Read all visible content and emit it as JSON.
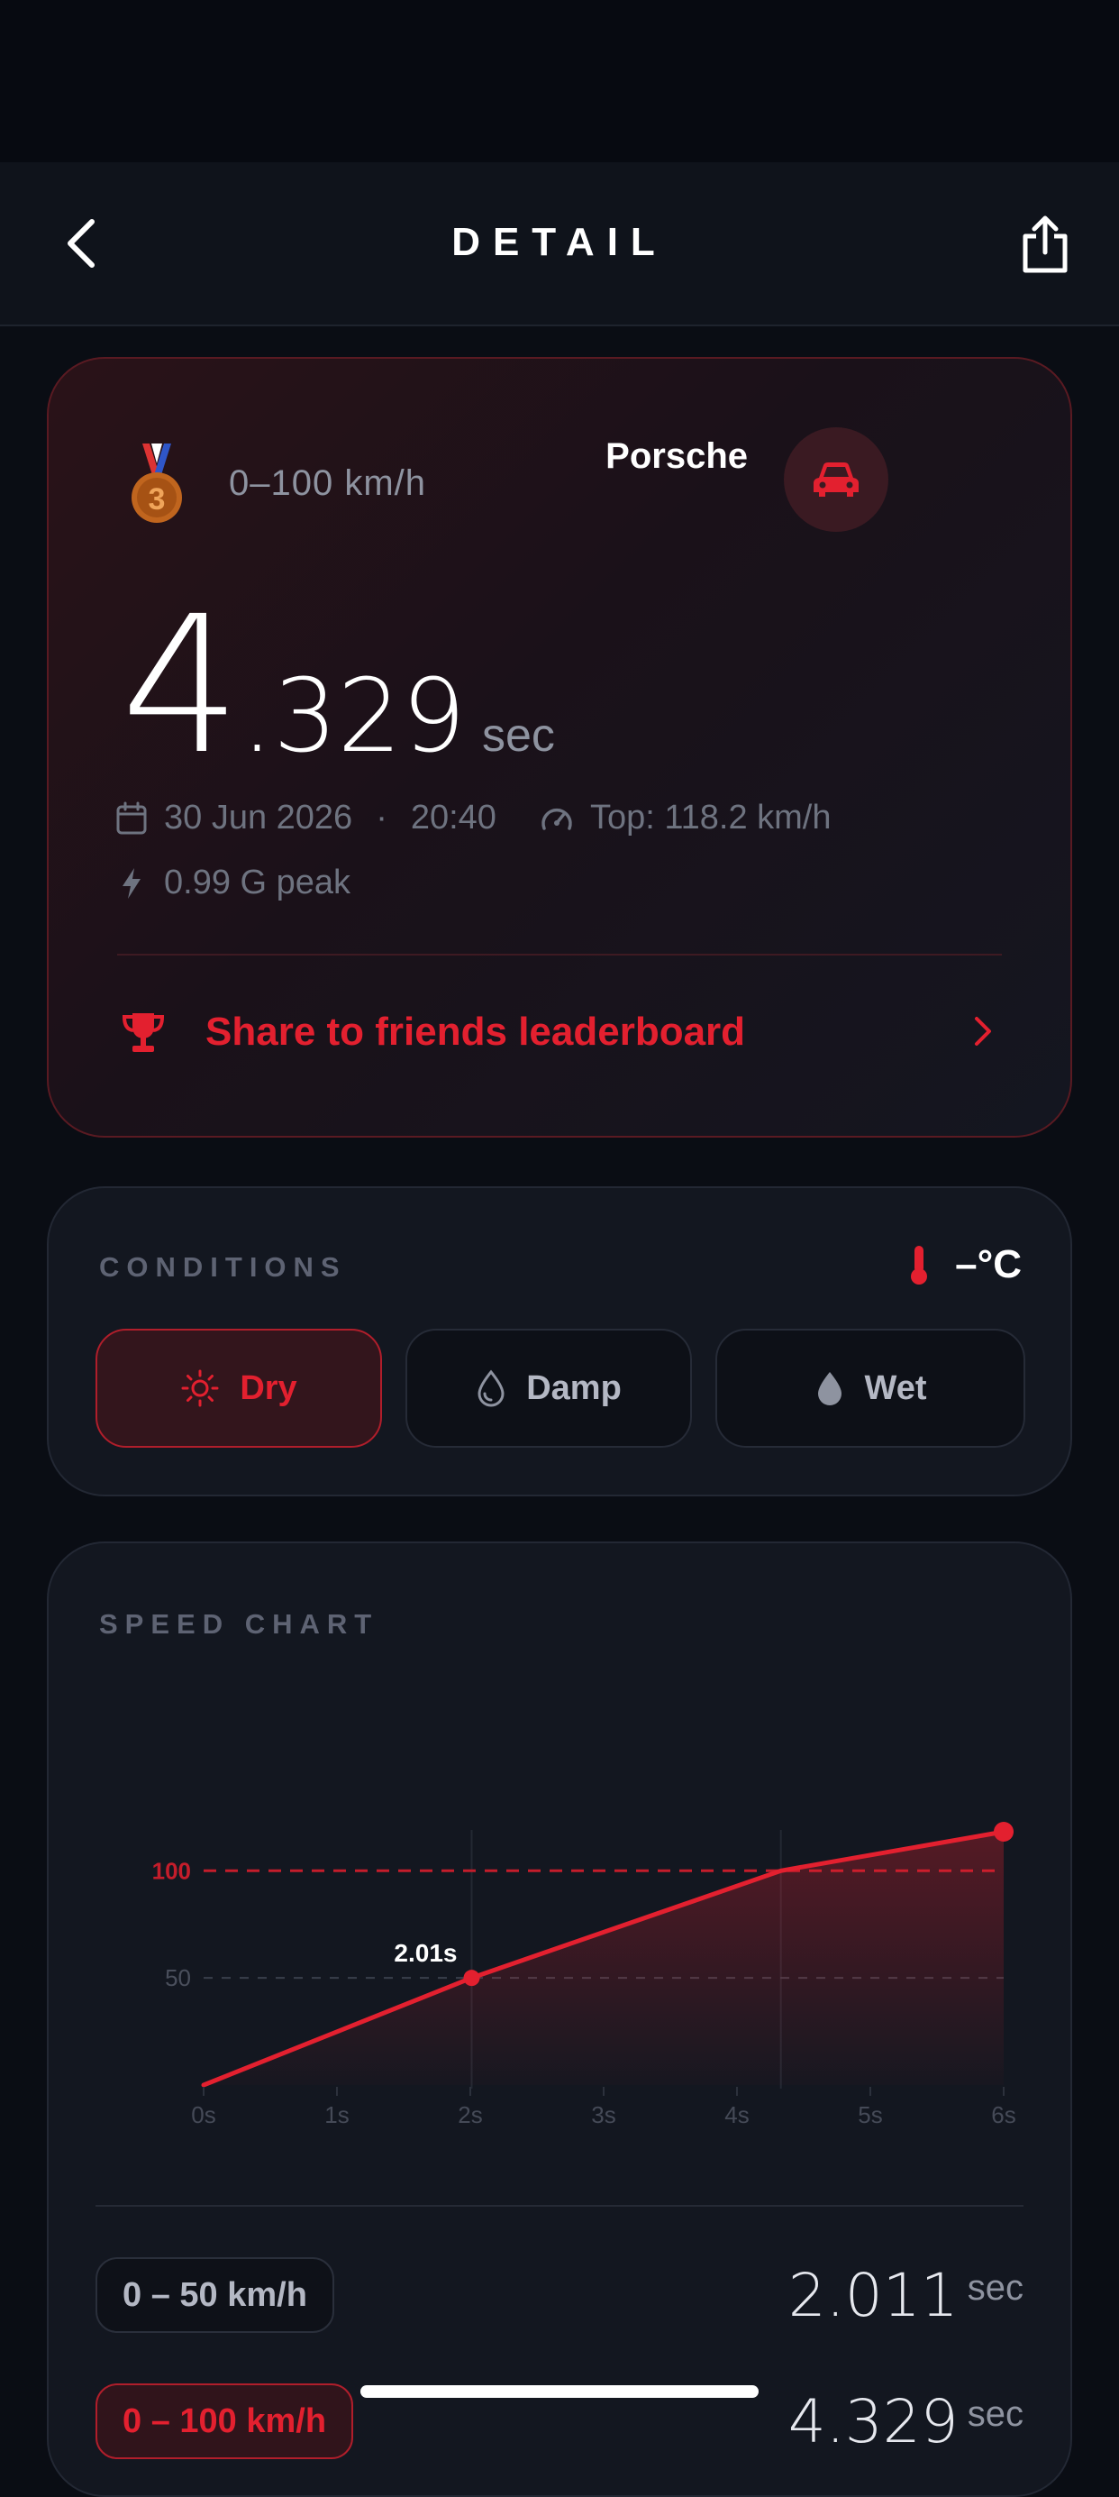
{
  "nav": {
    "title": "DETAIL"
  },
  "hero": {
    "metric_label": "0–100 km/h",
    "car_name": "Porsche",
    "time_integer": "4",
    "time_decimal": ".329",
    "time_unit": "sec",
    "date": "30 Jun 2026",
    "separator": "·",
    "clock": "20:40",
    "top_speed": "Top: 118.2 km/h",
    "g_peak": "0.99 G peak",
    "share_label": "Share to friends leaderboard",
    "medal_rank": "3"
  },
  "conditions": {
    "label": "CONDITIONS",
    "temperature": "–°C",
    "options": [
      {
        "label": "Dry",
        "selected": true
      },
      {
        "label": "Damp",
        "selected": false
      },
      {
        "label": "Wet",
        "selected": false
      }
    ]
  },
  "speed_chart": {
    "label": "SPEED CHART",
    "splits": [
      {
        "range": "0 – 50 km/h",
        "time": "2.011",
        "unit": "sec",
        "active": false
      },
      {
        "range": "0 – 100 km/h",
        "time": "4.329",
        "unit": "sec",
        "active": true
      }
    ]
  },
  "chart_data": {
    "type": "area",
    "x_unit": "s",
    "y_unit": "km/h",
    "x": [
      0,
      2.01,
      4.329,
      6
    ],
    "y": [
      0,
      50,
      100,
      118.2
    ],
    "xlim": [
      0,
      6
    ],
    "ylim": [
      0,
      118.2
    ],
    "xticks": [
      "0s",
      "1s",
      "2s",
      "3s",
      "4s",
      "5s",
      "6s"
    ],
    "reference_lines": [
      {
        "y": 100,
        "label": "100"
      },
      {
        "y": 50,
        "label": "50"
      }
    ],
    "annotations": [
      {
        "x": 2.01,
        "y": 50,
        "text": "2.01s"
      }
    ],
    "colors": {
      "line": "#e3202f",
      "grid": "#262b36"
    }
  },
  "colors": {
    "accent": "#e3202f",
    "background": "#0a0d14",
    "card": "#131720"
  }
}
